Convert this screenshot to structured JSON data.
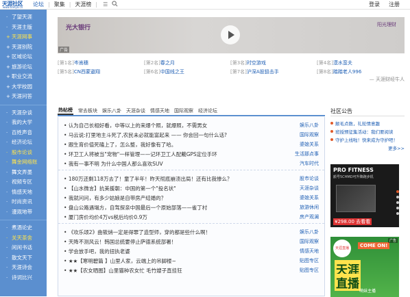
{
  "topbar": {
    "logo_main": "天涯社区",
    "logo_sub": "www.tianya.cn",
    "nav": [
      "论坛",
      "聚集",
      "天涯榜"
    ],
    "menu_icon": "menu-icon",
    "search_icon": "search-icon",
    "login": "登录",
    "register": "注册"
  },
  "sidebar": {
    "groups": [
      [
        {
          "label": "了望天涯",
          "prefix": "·",
          "highlight": false
        },
        {
          "label": "天涯主版",
          "prefix": "·",
          "highlight": false
        },
        {
          "label": "天涯网事",
          "prefix": "+",
          "highlight": true
        },
        {
          "label": "天涯别院",
          "prefix": "+",
          "highlight": false
        },
        {
          "label": "区域论坛",
          "prefix": "+",
          "highlight": false
        },
        {
          "label": "旅游论坛",
          "prefix": "+",
          "highlight": false
        },
        {
          "label": "职业交流",
          "prefix": "+",
          "highlight": false
        },
        {
          "label": "大学校园",
          "prefix": "+",
          "highlight": false
        },
        {
          "label": "天涯问答",
          "prefix": "+",
          "highlight": false
        }
      ],
      [
        {
          "label": "天涯杂谈",
          "prefix": "·",
          "highlight": false
        },
        {
          "label": "我的大学",
          "prefix": "·",
          "highlight": false
        },
        {
          "label": "百姓声音",
          "prefix": "·",
          "highlight": false
        },
        {
          "label": "经济论坛",
          "prefix": "·",
          "highlight": false
        },
        {
          "label": "股市论谈",
          "prefix": "·",
          "highlight": true
        },
        {
          "label": "舞金网络账",
          "prefix": "·",
          "highlight": true
        },
        {
          "label": "舞文弄墨",
          "prefix": "·",
          "highlight": false
        },
        {
          "label": "视频专区",
          "prefix": "·",
          "highlight": false
        },
        {
          "label": "情感天地",
          "prefix": "·",
          "highlight": false
        },
        {
          "label": "时尚资讯",
          "prefix": "·",
          "highlight": false
        },
        {
          "label": "漫观地带",
          "prefix": "·",
          "highlight": false
        }
      ],
      [
        {
          "label": "煮酒论史",
          "prefix": "·",
          "highlight": false
        },
        {
          "label": "关天茶舍",
          "prefix": "·",
          "highlight": true
        },
        {
          "label": "闲闲书话",
          "prefix": "·",
          "highlight": false
        },
        {
          "label": "散文天下",
          "prefix": "·",
          "highlight": false
        },
        {
          "label": "天涯诗会",
          "prefix": "·",
          "highlight": false
        },
        {
          "label": "诗词比兴",
          "prefix": "·",
          "highlight": false
        }
      ]
    ]
  },
  "banner": {
    "brand": "光大银行",
    "right_brand": "阳光理财",
    "ad_label": "广告",
    "play_icon": "play-icon"
  },
  "hot_ranks": [
    [
      {
        "num": "[第1名]",
        "title": "岑嵩穗"
      },
      {
        "num": "[第2名]",
        "title": "春之月"
      },
      {
        "num": "[第3名]",
        "title": "时空游戏"
      },
      {
        "num": "[第4名]",
        "title": "漠水蛮夫"
      }
    ],
    [
      {
        "num": "[第5名]",
        "title": "CN西蒙遨翔"
      },
      {
        "num": "[第6名]",
        "title": "中国线之王"
      },
      {
        "num": "[第7名]",
        "title": "沪深A股狙击手"
      },
      {
        "num": "[第8名]",
        "title": "踏踏老人996"
      }
    ]
  ],
  "more_rank": "天涯财经牛人",
  "tabs": [
    "热帖榜",
    "常去板块",
    "娱乐八卦",
    "天涯杂谈",
    "情感天地",
    "国际观察",
    "经济论坛"
  ],
  "post_groups": [
    [
      {
        "title": "认为自己长相好看，中等以上的来爆个照，就爆照，不需男女",
        "cat": "娱乐八卦"
      },
      {
        "title": "马云说:打里地主斗死了,农民未必就能富起来 —— 你会回一句什么话?",
        "cat": "国际观察"
      },
      {
        "title": "跟生育价值死磕上了，怎么整，我好像有了哈。",
        "cat": "婆媳关系"
      },
      {
        "title": "环卫工人将被当\"宠物\"一样管理——记环卫工人配戴GPS定位手环",
        "cat": "生活那点事"
      },
      {
        "title": "我有一事不明 为什么中国人那么喜欢SUV",
        "cat": "汽车时代"
      }
    ],
    [
      {
        "title": "180万还剩118万去了！童了半年！昨天彻底崩溃出局！还有比我惨么？",
        "cat": "股市论谈"
      },
      {
        "title": "【山水微言】抗美援朝：中国的第一个\"投名状\"",
        "cat": "天涯杂谈"
      },
      {
        "title": "我就问问，有多少姑娘是自带房产结婚的？",
        "cat": "婆媳关系"
      },
      {
        "title": "盘山公路遇塌方，自驾探亲中国最后一个原始部落——雀丁村",
        "cat": "旅游休闲"
      },
      {
        "title": "厦门房价均价4万vs税后均价0.9万",
        "cat": "房产观澜"
      }
    ],
    [
      {
        "title": "《欢乐颂2》曲筱绡一定是得罪了造型师，穿的都是些什么啊！",
        "cat": "娱乐八卦"
      },
      {
        "title": "天降不测风云！韩国总统要停止萨德系统部署！",
        "cat": "国际观察"
      },
      {
        "title": "学会放手吧，我的扭执老婆",
        "cat": "情感天地"
      },
      {
        "title": "★★【寒明碧篇 】山里人家，云端上的吊脚楼~",
        "cat": "贴图专区"
      },
      {
        "title": "★★【农女晒图】山里猫种农女忙 毛竹嫂子直挂狂",
        "cat": "贴图专区"
      }
    ]
  ],
  "notice": {
    "title": "社区公告",
    "items": [
      "颠毛点数，礼轮情意趣",
      "班授预征集活动：我们要阅读",
      "守护上线啦！快来成为守护吧！"
    ],
    "more": "更多>>"
  },
  "ad_right1": {
    "headline": "PRO FITNESS",
    "sub": "颜号5CHMD可升降跑步机",
    "price": "¥298.00 去看看",
    "label": "广告"
  },
  "ad_right2": {
    "badge": "天涯直播",
    "come": "COME ON!",
    "line1": "天涯",
    "line2": "直播",
    "sub": "萌妹主播",
    "label": "广告"
  },
  "colors": {
    "sidebar_bg": "#5b8fcf",
    "link": "#1f5fb4",
    "highlight": "#ffe44d",
    "accent": "#e05a2a"
  }
}
